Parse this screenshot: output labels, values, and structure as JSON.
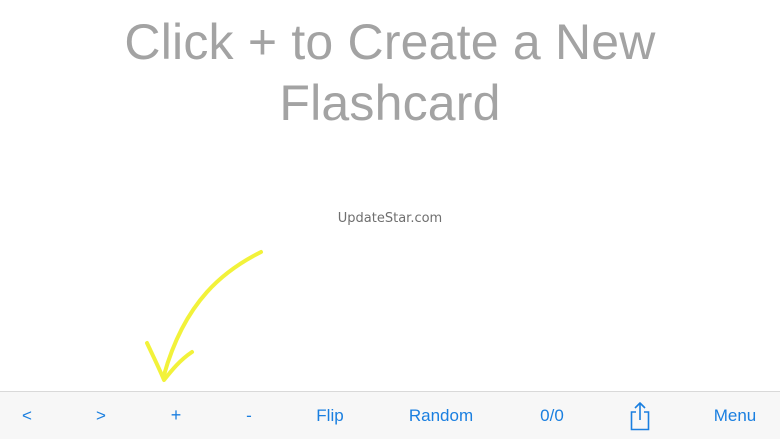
{
  "content": {
    "headline_line1": "Click + to Create a New",
    "headline_line2": "Flashcard",
    "watermark": "UpdateStar.com"
  },
  "toolbar": {
    "prev_label": "<",
    "next_label": ">",
    "add_label": "+",
    "remove_label": "-",
    "flip_label": "Flip",
    "random_label": "Random",
    "card_count": "0/0",
    "share_icon": "share-icon",
    "menu_label": "Menu"
  },
  "colors": {
    "accent": "#1a7fe0",
    "headline": "#a3a3a3",
    "arrow_annotation": "#f2f23a",
    "toolbar_bg": "#f7f7f7"
  }
}
